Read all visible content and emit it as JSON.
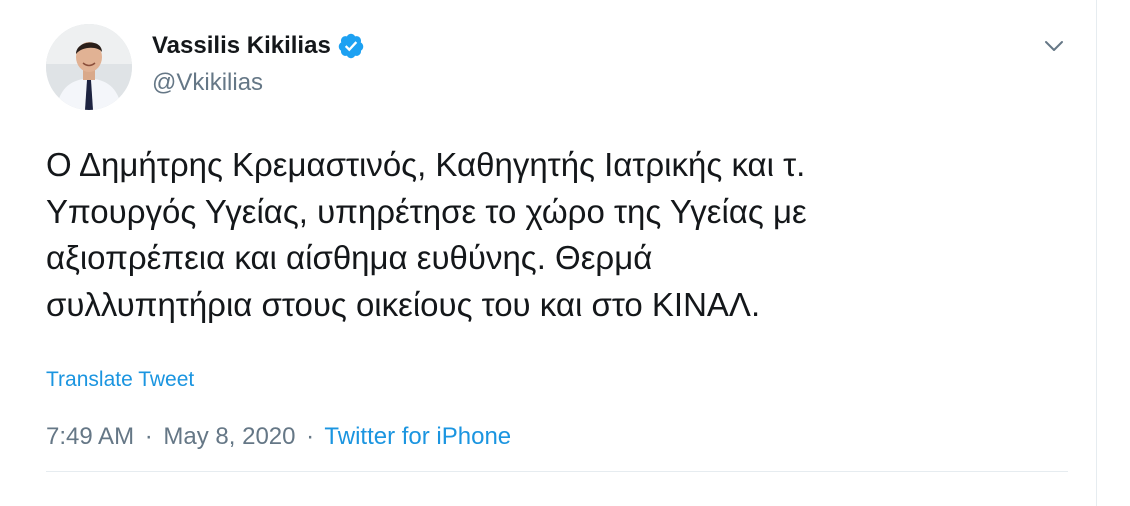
{
  "tweet": {
    "display_name": "Vassilis Kikilias",
    "handle": "@Vkikilias",
    "verified": true,
    "text_lines": [
      "Ο Δημήτρης Κρεμαστινός, Καθηγητής Ιατρικής και τ.",
      "Υπουργός Υγείας, υπηρέτησε το χώρο της Υγείας με",
      "αξιοπρέπεια και αίσθημα ευθύνης. Θερμά",
      "συλλυπητήρια στους οικείους του και στο ΚΙΝΑΛ."
    ],
    "translate_label": "Translate Tweet",
    "time": "7:49 AM",
    "separator": "·",
    "date": "May 8, 2020",
    "source": "Twitter for iPhone"
  },
  "icons": {
    "verified": "verified-badge-icon",
    "caret": "chevron-down-icon"
  },
  "colors": {
    "text": "#14171a",
    "secondary": "#657786",
    "link": "#1b95e0",
    "verified": "#1da1f2",
    "divider": "#e6ecf0"
  }
}
